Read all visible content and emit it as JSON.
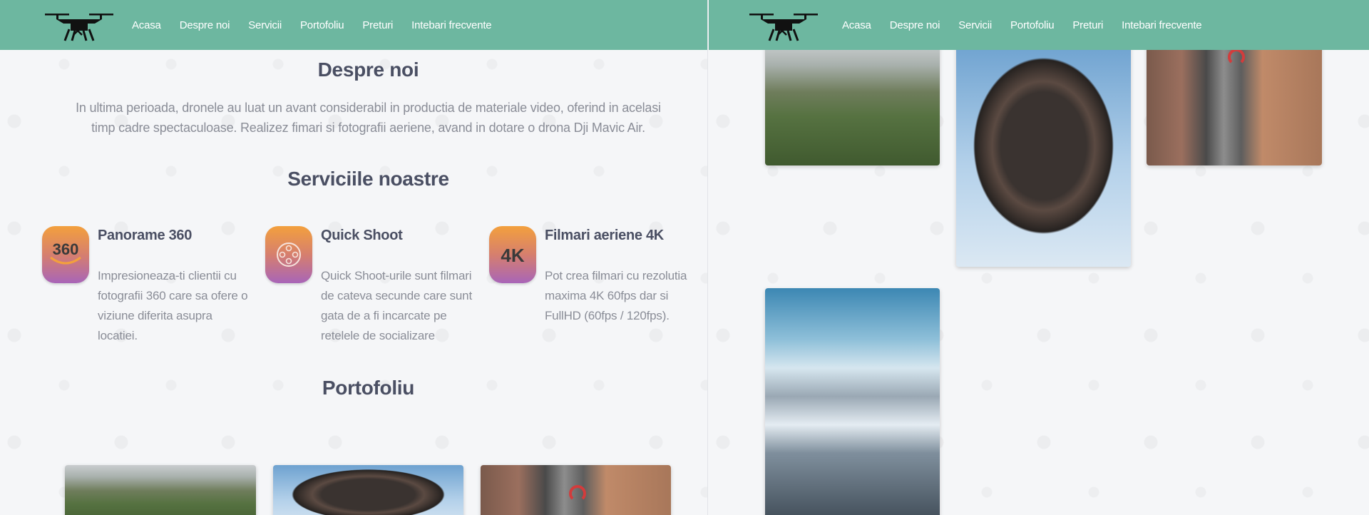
{
  "nav": {
    "items": [
      "Acasa",
      "Despre noi",
      "Servicii",
      "Portofoliu",
      "Preturi",
      "Intebari frecvente"
    ]
  },
  "about": {
    "title": "Despre noi",
    "text": "In ultima perioada, dronele au luat un avant considerabil in productia de materiale video, oferind in acelasi timp cadre spectaculoase. Realizez fimari si fotografii aeriene, avand in dotare o drona Dji Mavic Air."
  },
  "services": {
    "title": "Serviciile noastre",
    "items": [
      {
        "title": "Panorame 360",
        "text": "Impresioneaza-ti clientii cu fotografii 360 care sa ofere o viziune diferita asupra locatiei.",
        "icon": "panorama-360-icon"
      },
      {
        "title": "Quick Shoot",
        "text": "Quick Shoot-urile sunt filmari de cateva secunde care sunt gata de a fi incarcate pe retelele de socializare",
        "icon": "film-reel-icon"
      },
      {
        "title": "Filmari aeriene 4K",
        "text": "Pot crea filmari cu rezolutia maxima 4K 60fps dar si FullHD (60fps / 120fps).",
        "icon": "4k-icon"
      }
    ],
    "icon_labels": {
      "panorama": "360",
      "resolution": "4K"
    }
  },
  "portfolio": {
    "title": "Portofoliu"
  },
  "colors": {
    "navbar": "#6db7a0",
    "background": "#f5f6f8",
    "heading": "#4a4f63",
    "body_text": "#8a8d97"
  }
}
